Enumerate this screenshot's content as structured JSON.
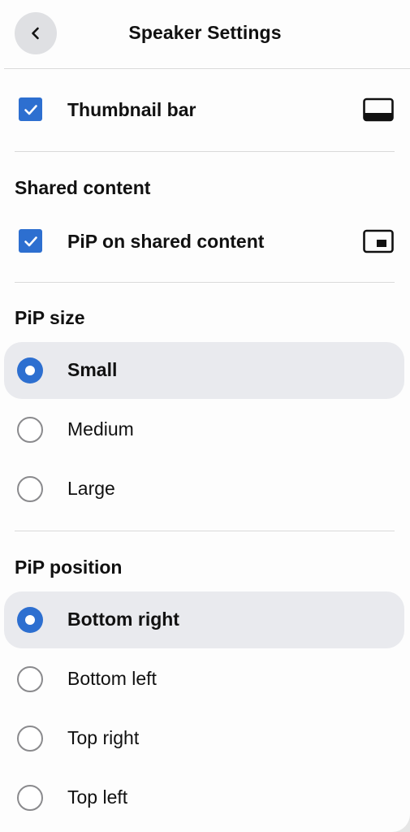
{
  "header": {
    "title": "Speaker Settings",
    "back_icon": "chevron-left-icon"
  },
  "thumbnail_bar": {
    "label": "Thumbnail bar",
    "checked": true,
    "icon": "thumbnail-bar-icon"
  },
  "shared_content": {
    "title": "Shared content",
    "pip": {
      "label": "PiP on shared content",
      "checked": true,
      "icon": "pip-icon"
    }
  },
  "pip_size": {
    "title": "PiP size",
    "selected": "Small",
    "options": [
      "Small",
      "Medium",
      "Large"
    ]
  },
  "pip_position": {
    "title": "PiP position",
    "selected": "Bottom right",
    "options": [
      "Bottom right",
      "Bottom left",
      "Top right",
      "Top left"
    ]
  },
  "colors": {
    "accent": "#2d6fd0",
    "selected_bg": "#e9eaee",
    "divider": "#dadada"
  }
}
